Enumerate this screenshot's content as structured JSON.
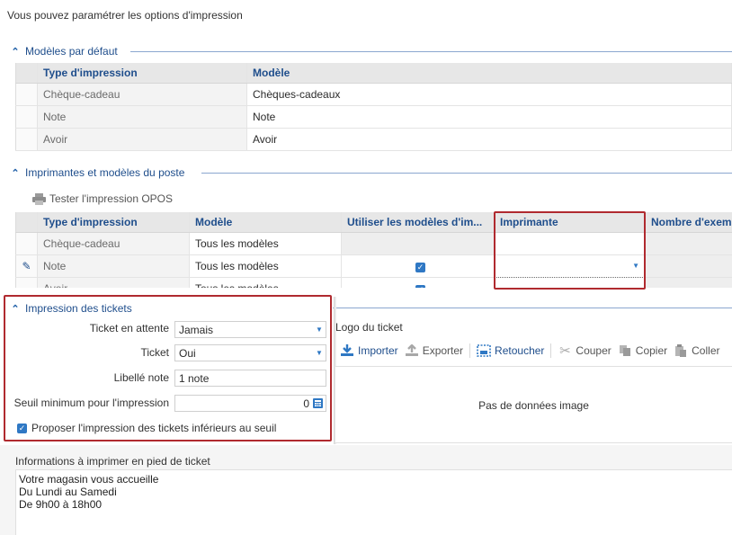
{
  "intro": "Vous pouvez paramétrer les options d'impression",
  "sections": {
    "default_models": "Modèles par défaut",
    "printers": "Imprimantes et modèles du poste",
    "tickets": "Impression des tickets"
  },
  "default_grid": {
    "headers": [
      "Type d'impression",
      "Modèle"
    ],
    "rows": [
      [
        "Chèque-cadeau",
        "Chèques-cadeaux"
      ],
      [
        "Note",
        "Note"
      ],
      [
        "Avoir",
        "Avoir"
      ]
    ]
  },
  "printers_toolbar": {
    "test_label": "Tester l'impression OPOS"
  },
  "printers_grid": {
    "headers": [
      "Type d'impression",
      "Modèle",
      "Utiliser les modèles d'im...",
      "Imprimante",
      "Nombre d'exem"
    ],
    "rows": [
      {
        "type": "Chèque-cadeau",
        "model": "Tous les modèles",
        "use": false
      },
      {
        "type": "Note",
        "model": "Tous les modèles",
        "use": true
      },
      {
        "type": "Avoir",
        "model": "Tous les modèles",
        "use": true
      }
    ]
  },
  "tickets": {
    "pending_label": "Ticket en attente",
    "pending_value": "Jamais",
    "ticket_label": "Ticket",
    "ticket_value": "Oui",
    "note_label": "Libellé note",
    "note_value": "1 note",
    "threshold_label": "Seuil minimum pour l'impression",
    "threshold_value": "0",
    "propose_label": "Proposer l'impression des tickets inférieurs au seuil",
    "propose_checked": true
  },
  "logo": {
    "title": "Logo du ticket",
    "import": "Importer",
    "export": "Exporter",
    "retouch": "Retoucher",
    "cut": "Couper",
    "copy": "Copier",
    "paste": "Coller",
    "empty": "Pas de données image"
  },
  "footer": {
    "label": "Informations à imprimer en pied de ticket",
    "text": "Votre magasin vous accueille\nDu Lundi au Samedi\nDe 9h00 à 18h00"
  }
}
